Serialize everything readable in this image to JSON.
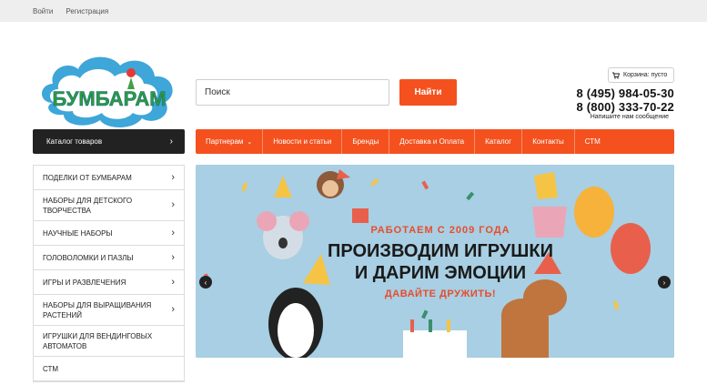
{
  "topbar": {
    "login": "Войти",
    "register": "Регистрация"
  },
  "logo": {
    "text": "БУМБАРАМ"
  },
  "search": {
    "placeholder": "Поиск",
    "button": "Найти"
  },
  "cart": {
    "label": "Корзина: пусто"
  },
  "contacts": {
    "phone1": "8 (495) 984-05-30",
    "phone2": "8 (800) 333-70-22",
    "message": "Напишите нам сообщение"
  },
  "catalog_button": "Каталог товаров",
  "nav": {
    "items": [
      {
        "label": "Партнерам"
      },
      {
        "label": "Новости и статьи"
      },
      {
        "label": "Бренды"
      },
      {
        "label": "Доставка и Оплата"
      },
      {
        "label": "Каталог"
      },
      {
        "label": "Контакты"
      },
      {
        "label": "СТМ"
      }
    ]
  },
  "sidebar": {
    "items": [
      {
        "label": "ПОДЕЛКИ ОТ БУМБАРАМ"
      },
      {
        "label": "НАБОРЫ ДЛЯ ДЕТСКОГО ТВОРЧЕСТВА"
      },
      {
        "label": "НАУЧНЫЕ НАБОРЫ"
      },
      {
        "label": "ГОЛОВОЛОМКИ И ПАЗЛЫ"
      },
      {
        "label": "ИГРЫ И РАЗВЛЕЧЕНИЯ"
      },
      {
        "label": "НАБОРЫ ДЛЯ ВЫРАЩИВАНИЯ РАСТЕНИЙ"
      },
      {
        "label": "ИГРУШКИ ДЛЯ ВЕНДИНГОВЫХ АВТОМАТОВ"
      },
      {
        "label": "СТМ"
      }
    ]
  },
  "banner": {
    "line1": "РАБОТАЕМ С 2009 ГОДА",
    "line2": "ПРОИЗВОДИМ ИГРУШКИ",
    "line3": "И ДАРИМ ЭМОЦИИ",
    "line4": "ДАВАЙТЕ ДРУЖИТЬ!"
  },
  "colors": {
    "accent": "#f4511e",
    "dark": "#222222",
    "banner_bg": "#a8cfe3"
  }
}
